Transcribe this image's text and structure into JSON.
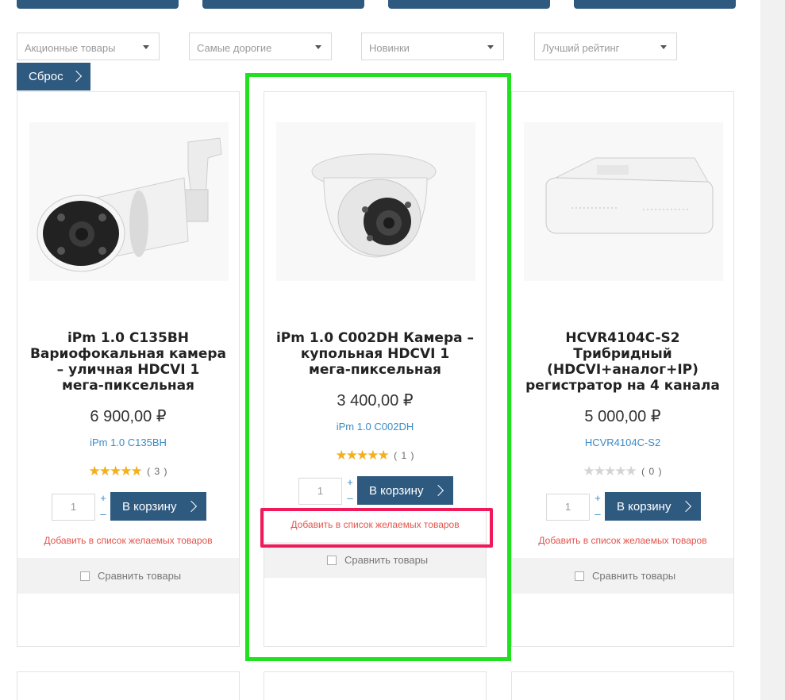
{
  "filters": [
    {
      "label": "Акционные товары"
    },
    {
      "label": "Самые дорогие"
    },
    {
      "label": "Новинки"
    },
    {
      "label": "Лучший рейтинг"
    }
  ],
  "reset_label": "Сброс",
  "products": [
    {
      "image": "bullet-camera-image",
      "title_lines": [
        "iPm 1.0 C135BH",
        "Вариофокальная камера",
        "– уличная HDCVI 1",
        "мега-пиксельная"
      ],
      "price": "6 900,00 ₽",
      "sku": "iPm 1.0 C135BH",
      "rating": 5,
      "rating_count": "( 3 )",
      "quantity": "1",
      "cart_label": "В корзину",
      "wishlist_label": "Добавить в список желаемых товаров",
      "compare_label": "Сравнить товары"
    },
    {
      "image": "dome-camera-image",
      "title_lines": [
        "iPm 1.0 C002DH Камера –",
        "купольная HDCVI 1",
        "мега-пиксельная"
      ],
      "price": "3 400,00 ₽",
      "sku": "iPm 1.0 C002DH",
      "rating": 5,
      "rating_count": "( 1 )",
      "quantity": "1",
      "cart_label": "В корзину",
      "wishlist_label": "Добавить в список желаемых товаров",
      "compare_label": "Сравнить товары"
    },
    {
      "image": "dvr-recorder-image",
      "title_lines": [
        "HCVR4104C-S2",
        "Трибридный",
        "(HDCVI+аналог+IP)",
        "регистратор на 4 канала"
      ],
      "price": "5 000,00 ₽",
      "sku": "HCVR4104C-S2",
      "rating": 0,
      "rating_count": "( 0 )",
      "quantity": "1",
      "cart_label": "В корзину",
      "wishlist_label": "Добавить в список желаемых товаров",
      "compare_label": "Сравнить товары"
    }
  ],
  "colors": {
    "accent": "#2f5a80",
    "link": "#3b8bc7",
    "wishlist": "#e5534b",
    "star": "#f2b01e",
    "highlight_green": "#1fe11f",
    "highlight_pink": "#f0195a"
  }
}
